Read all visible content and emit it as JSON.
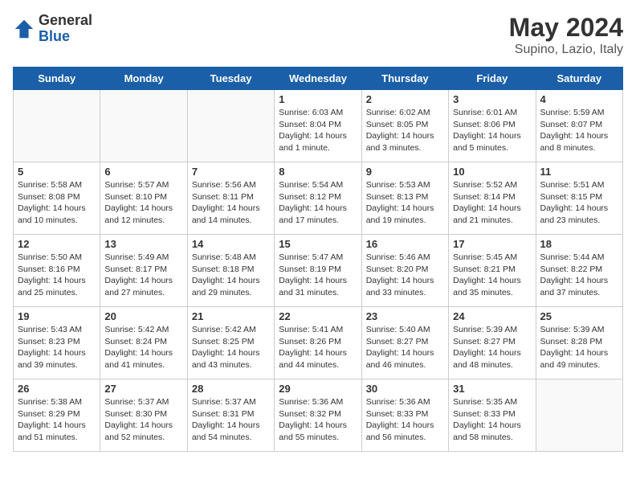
{
  "logo": {
    "general": "General",
    "blue": "Blue"
  },
  "title": {
    "month_year": "May 2024",
    "location": "Supino, Lazio, Italy"
  },
  "days_of_week": [
    "Sunday",
    "Monday",
    "Tuesday",
    "Wednesday",
    "Thursday",
    "Friday",
    "Saturday"
  ],
  "weeks": [
    [
      {
        "day": "",
        "info": ""
      },
      {
        "day": "",
        "info": ""
      },
      {
        "day": "",
        "info": ""
      },
      {
        "day": "1",
        "info": "Sunrise: 6:03 AM\nSunset: 8:04 PM\nDaylight: 14 hours\nand 1 minute."
      },
      {
        "day": "2",
        "info": "Sunrise: 6:02 AM\nSunset: 8:05 PM\nDaylight: 14 hours\nand 3 minutes."
      },
      {
        "day": "3",
        "info": "Sunrise: 6:01 AM\nSunset: 8:06 PM\nDaylight: 14 hours\nand 5 minutes."
      },
      {
        "day": "4",
        "info": "Sunrise: 5:59 AM\nSunset: 8:07 PM\nDaylight: 14 hours\nand 8 minutes."
      }
    ],
    [
      {
        "day": "5",
        "info": "Sunrise: 5:58 AM\nSunset: 8:08 PM\nDaylight: 14 hours\nand 10 minutes."
      },
      {
        "day": "6",
        "info": "Sunrise: 5:57 AM\nSunset: 8:10 PM\nDaylight: 14 hours\nand 12 minutes."
      },
      {
        "day": "7",
        "info": "Sunrise: 5:56 AM\nSunset: 8:11 PM\nDaylight: 14 hours\nand 14 minutes."
      },
      {
        "day": "8",
        "info": "Sunrise: 5:54 AM\nSunset: 8:12 PM\nDaylight: 14 hours\nand 17 minutes."
      },
      {
        "day": "9",
        "info": "Sunrise: 5:53 AM\nSunset: 8:13 PM\nDaylight: 14 hours\nand 19 minutes."
      },
      {
        "day": "10",
        "info": "Sunrise: 5:52 AM\nSunset: 8:14 PM\nDaylight: 14 hours\nand 21 minutes."
      },
      {
        "day": "11",
        "info": "Sunrise: 5:51 AM\nSunset: 8:15 PM\nDaylight: 14 hours\nand 23 minutes."
      }
    ],
    [
      {
        "day": "12",
        "info": "Sunrise: 5:50 AM\nSunset: 8:16 PM\nDaylight: 14 hours\nand 25 minutes."
      },
      {
        "day": "13",
        "info": "Sunrise: 5:49 AM\nSunset: 8:17 PM\nDaylight: 14 hours\nand 27 minutes."
      },
      {
        "day": "14",
        "info": "Sunrise: 5:48 AM\nSunset: 8:18 PM\nDaylight: 14 hours\nand 29 minutes."
      },
      {
        "day": "15",
        "info": "Sunrise: 5:47 AM\nSunset: 8:19 PM\nDaylight: 14 hours\nand 31 minutes."
      },
      {
        "day": "16",
        "info": "Sunrise: 5:46 AM\nSunset: 8:20 PM\nDaylight: 14 hours\nand 33 minutes."
      },
      {
        "day": "17",
        "info": "Sunrise: 5:45 AM\nSunset: 8:21 PM\nDaylight: 14 hours\nand 35 minutes."
      },
      {
        "day": "18",
        "info": "Sunrise: 5:44 AM\nSunset: 8:22 PM\nDaylight: 14 hours\nand 37 minutes."
      }
    ],
    [
      {
        "day": "19",
        "info": "Sunrise: 5:43 AM\nSunset: 8:23 PM\nDaylight: 14 hours\nand 39 minutes."
      },
      {
        "day": "20",
        "info": "Sunrise: 5:42 AM\nSunset: 8:24 PM\nDaylight: 14 hours\nand 41 minutes."
      },
      {
        "day": "21",
        "info": "Sunrise: 5:42 AM\nSunset: 8:25 PM\nDaylight: 14 hours\nand 43 minutes."
      },
      {
        "day": "22",
        "info": "Sunrise: 5:41 AM\nSunset: 8:26 PM\nDaylight: 14 hours\nand 44 minutes."
      },
      {
        "day": "23",
        "info": "Sunrise: 5:40 AM\nSunset: 8:27 PM\nDaylight: 14 hours\nand 46 minutes."
      },
      {
        "day": "24",
        "info": "Sunrise: 5:39 AM\nSunset: 8:27 PM\nDaylight: 14 hours\nand 48 minutes."
      },
      {
        "day": "25",
        "info": "Sunrise: 5:39 AM\nSunset: 8:28 PM\nDaylight: 14 hours\nand 49 minutes."
      }
    ],
    [
      {
        "day": "26",
        "info": "Sunrise: 5:38 AM\nSunset: 8:29 PM\nDaylight: 14 hours\nand 51 minutes."
      },
      {
        "day": "27",
        "info": "Sunrise: 5:37 AM\nSunset: 8:30 PM\nDaylight: 14 hours\nand 52 minutes."
      },
      {
        "day": "28",
        "info": "Sunrise: 5:37 AM\nSunset: 8:31 PM\nDaylight: 14 hours\nand 54 minutes."
      },
      {
        "day": "29",
        "info": "Sunrise: 5:36 AM\nSunset: 8:32 PM\nDaylight: 14 hours\nand 55 minutes."
      },
      {
        "day": "30",
        "info": "Sunrise: 5:36 AM\nSunset: 8:33 PM\nDaylight: 14 hours\nand 56 minutes."
      },
      {
        "day": "31",
        "info": "Sunrise: 5:35 AM\nSunset: 8:33 PM\nDaylight: 14 hours\nand 58 minutes."
      },
      {
        "day": "",
        "info": ""
      }
    ]
  ]
}
